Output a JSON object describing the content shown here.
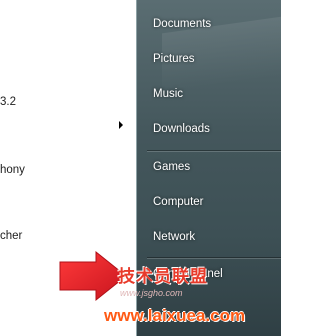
{
  "left_pane": {
    "items": [
      {
        "label": "3.2"
      },
      {
        "label": "hony"
      },
      {
        "label": "cher"
      }
    ]
  },
  "right_pane": {
    "items": [
      {
        "label": "Documents"
      },
      {
        "label": "Pictures"
      },
      {
        "label": "Music"
      },
      {
        "label": "Downloads"
      },
      {
        "label": "Games"
      },
      {
        "label": "Computer"
      },
      {
        "label": "Network"
      },
      {
        "label": "Control Panel"
      }
    ]
  },
  "watermark": {
    "site_name": "技术员联盟",
    "url_small": "www.jsgho.com",
    "url": "www.laixuea.com"
  },
  "colors": {
    "right_pane_bg": "#44575c",
    "arrow": "#e8232d",
    "watermark_url": "#ff5a14"
  }
}
